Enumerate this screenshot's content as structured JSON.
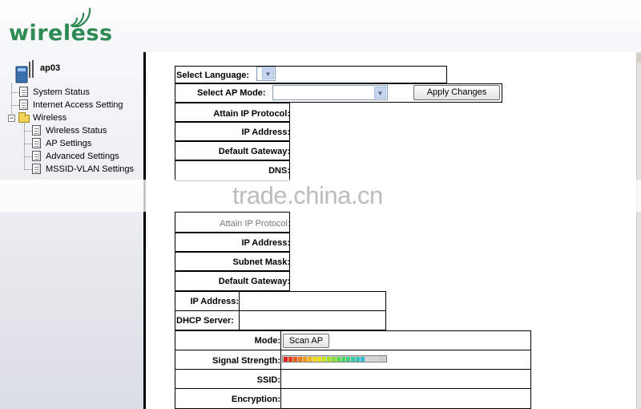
{
  "brand": {
    "logo_text": "wireless",
    "logo_color": "#2c8a52"
  },
  "sidebar": {
    "device_name": "ap03",
    "items": [
      {
        "label": "System Status",
        "icon": "document-icon"
      },
      {
        "label": "Internet Access Setting",
        "icon": "document-icon"
      },
      {
        "label": "Wireless",
        "icon": "folder-icon",
        "expanded": true
      },
      {
        "label": "Wireless Status",
        "icon": "document-icon"
      },
      {
        "label": "AP Settings",
        "icon": "document-icon"
      },
      {
        "label": "Advanced Settings",
        "icon": "document-icon"
      },
      {
        "label": "MSSID-VLAN Settings",
        "icon": "document-icon"
      }
    ]
  },
  "form": {
    "select_language_label": "Select Language:",
    "select_language_value": "",
    "select_ap_mode_label": "Select AP Mode:",
    "select_ap_mode_value": "",
    "apply_button": "Apply Changes"
  },
  "wan_status": {
    "attain_ip_protocol": "Attain IP Protocol:",
    "ip_address": "IP Address:",
    "default_gateway": "Default Gateway:",
    "dns": "DNS:"
  },
  "lan_status": {
    "attain_ip_protocol": "Attain IP Protocol:",
    "ip_address": "IP Address:",
    "subnet_mask": "Subnet Mask:",
    "default_gateway": "Default Gateway:"
  },
  "lan_dhcp": {
    "ip_address": "IP Address:",
    "dhcp_server": "DHCP Server:"
  },
  "wireless_status": {
    "mode_label": "Mode:",
    "scan_button": "Scan AP",
    "signal_strength_label": "Signal Strength:",
    "signal_strength_level": 0.85,
    "ssid_label": "SSID:",
    "encryption_label": "Encryption:"
  },
  "watermark": {
    "text": "trade.china.cn"
  }
}
